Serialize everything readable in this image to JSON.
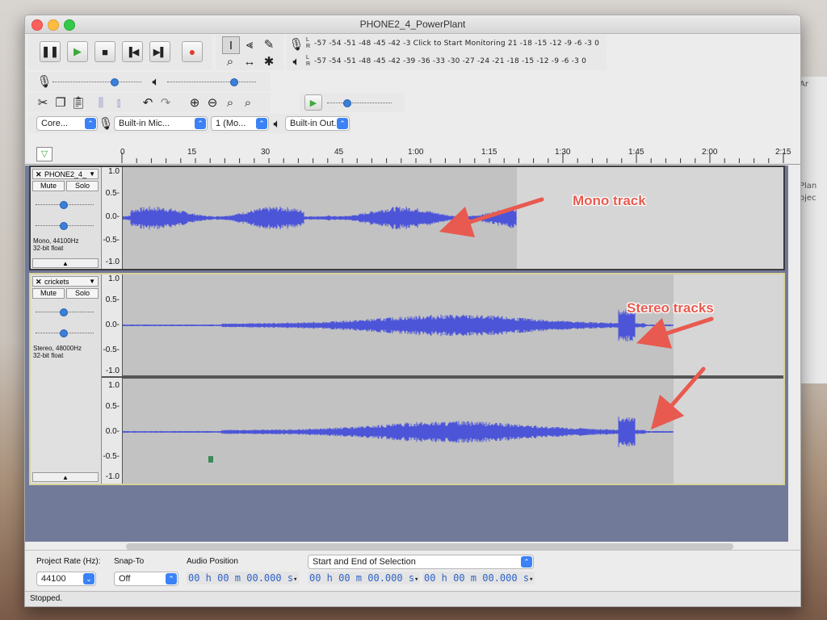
{
  "window": {
    "title": "PHONE2_4_PowerPlant"
  },
  "colors": {
    "waveform": "#4c55d8",
    "annotation": "#e85a4f",
    "track_bg": "#c5c5c5",
    "tracks_area_bg": "#727a99"
  },
  "transport": {
    "pause": "pause-icon",
    "play": "play-icon",
    "stop": "stop-icon",
    "skip_start": "skip-to-start-icon",
    "skip_end": "skip-to-end-icon",
    "record": "record-icon"
  },
  "tools": {
    "selection": "I-beam-icon",
    "envelope": "envelope-icon",
    "draw": "pencil-icon",
    "zoom": "zoom-icon",
    "timeshift": "timeshift-icon",
    "multi": "multi-tool-icon"
  },
  "meters": {
    "record_scale": "-57 -54 -51 -48 -45 -42 -3 Click to Start Monitoring 21 -18 -15 -12 -9 -6 -3 0",
    "play_scale": "-57 -54 -51 -48 -45 -42 -39 -36 -33 -30 -27 -24 -21 -18 -15 -12 -9 -6 -3 0"
  },
  "devices": {
    "host": "Core...",
    "input": "Built-in Mic...",
    "channels": "1 (Mo...",
    "output": "Built-in Out..."
  },
  "ruler": {
    "labels": [
      "0",
      "15",
      "30",
      "45",
      "1:00",
      "1:15",
      "1:30",
      "1:45",
      "2:00",
      "2:15"
    ]
  },
  "tracks": [
    {
      "name": "PHONE2_4_",
      "mute": "Mute",
      "solo": "Solo",
      "info_line1": "Mono, 44100Hz",
      "info_line2": "32-bit float",
      "scale": [
        "1.0",
        "0.5-",
        "0.0-",
        "-0.5-",
        "-1.0"
      ]
    },
    {
      "name": "crickets",
      "mute": "Mute",
      "solo": "Solo",
      "info_line1": "Stereo, 48000Hz",
      "info_line2": "32-bit float",
      "scale_left": [
        "1.0",
        "0.5-",
        "0.0-",
        "-0.5-",
        "-1.0"
      ],
      "scale_right": [
        "1.0",
        "0.5-",
        "0.0-",
        "-0.5-",
        "-1.0"
      ]
    }
  ],
  "annotations": {
    "mono": "Mono track",
    "stereo": "Stereo tracks"
  },
  "selection_bar": {
    "project_rate_label": "Project Rate (Hz):",
    "project_rate_value": "44100",
    "snap_label": "Snap-To",
    "snap_value": "Off",
    "audio_position_label": "Audio Position",
    "audio_position": "00 h 00 m 00.000 s",
    "selection_mode": "Start and End of Selection",
    "selection_start": "00 h 00 m 00.000 s",
    "selection_end": "00 h 00 m 00.000 s"
  },
  "status": "Stopped."
}
